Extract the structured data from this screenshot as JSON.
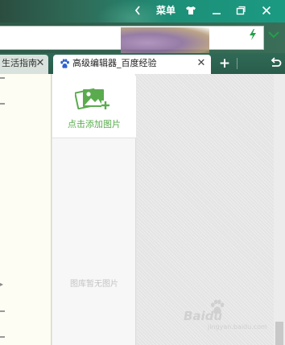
{
  "titlebar": {
    "back_icon": "chevron-left-icon",
    "menu_label": "菜单",
    "skin_icon": "shirt-icon",
    "minimize_icon": "minimize-icon",
    "maximize_icon": "maximize-icon",
    "close_icon": "close-icon"
  },
  "addressbar": {
    "value": "",
    "fast_mode_icon": "lightning-icon",
    "dropdown_icon": "chevron-down-icon"
  },
  "tabs": [
    {
      "label": "生活指南",
      "active": false
    },
    {
      "label": "高级编辑器_百度经验",
      "active": true,
      "icon": "baidu-paw-icon"
    }
  ],
  "tab_close_glyph": "✕",
  "new_tab_label": "+",
  "undo_icon": "undo-icon",
  "gallery": {
    "add_image_label": "点击添加图片",
    "empty_text": "图库暂无图片"
  },
  "watermark": {
    "brand": "Baidu",
    "sub": "jingyan.baidu.com"
  },
  "colors": {
    "accent_green": "#5aab4e",
    "titlebar": "#1b9a82",
    "baidu_blue": "#2e62cd"
  }
}
